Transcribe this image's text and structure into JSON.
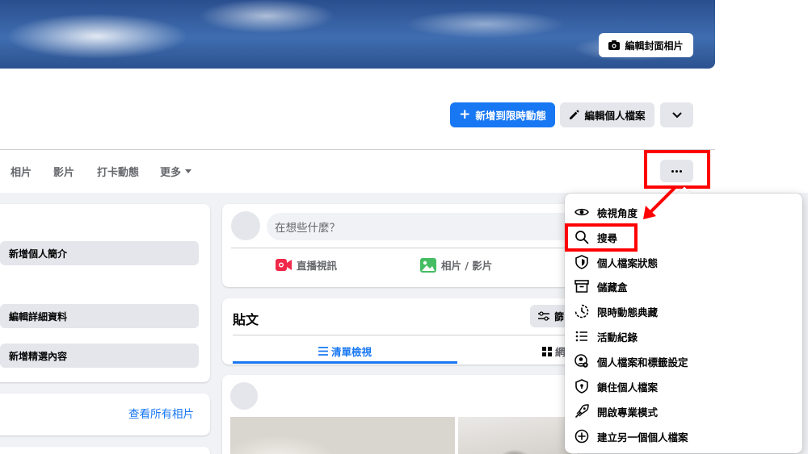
{
  "cover": {
    "edit_label": "編輯封面相片"
  },
  "header_actions": {
    "add_story_label": "新增到限時動態",
    "edit_profile_label": "編輯個人檔案"
  },
  "tabs": [
    {
      "label": "相片"
    },
    {
      "label": "影片"
    },
    {
      "label": "打卡動態"
    },
    {
      "label": "更多"
    }
  ],
  "intro": {
    "add_bio": "新增個人簡介",
    "edit_details": "編輯詳細資料",
    "add_featured": "新增精選內容"
  },
  "photos": {
    "see_all": "查看所有相片"
  },
  "composer": {
    "placeholder": "在想些什麼？",
    "live_label": "直播視訊",
    "photo_label": "相片 / 影片"
  },
  "posts": {
    "title": "貼文",
    "filter_label": "篩",
    "list_view": "清單檢視",
    "grid_view": "網"
  },
  "menu": {
    "items": [
      {
        "label": "檢視角度",
        "icon": "eye-icon"
      },
      {
        "label": "搜尋",
        "icon": "search-icon"
      },
      {
        "label": "個人檔案狀態",
        "icon": "shield-icon"
      },
      {
        "label": "儲藏盒",
        "icon": "archive-icon"
      },
      {
        "label": "限時動態典藏",
        "icon": "story-archive-icon"
      },
      {
        "label": "活動紀錄",
        "icon": "list-icon"
      },
      {
        "label": "個人檔案和標籤設定",
        "icon": "profile-settings-icon"
      },
      {
        "label": "鎖住個人檔案",
        "icon": "lock-shield-icon"
      },
      {
        "label": "開啟專業模式",
        "icon": "professional-icon"
      },
      {
        "label": "建立另一個個人檔案",
        "icon": "plus-circle-icon"
      }
    ]
  },
  "colors": {
    "accent": "#1877f2",
    "highlight": "#ff0000",
    "background": "#f0f2f5"
  }
}
